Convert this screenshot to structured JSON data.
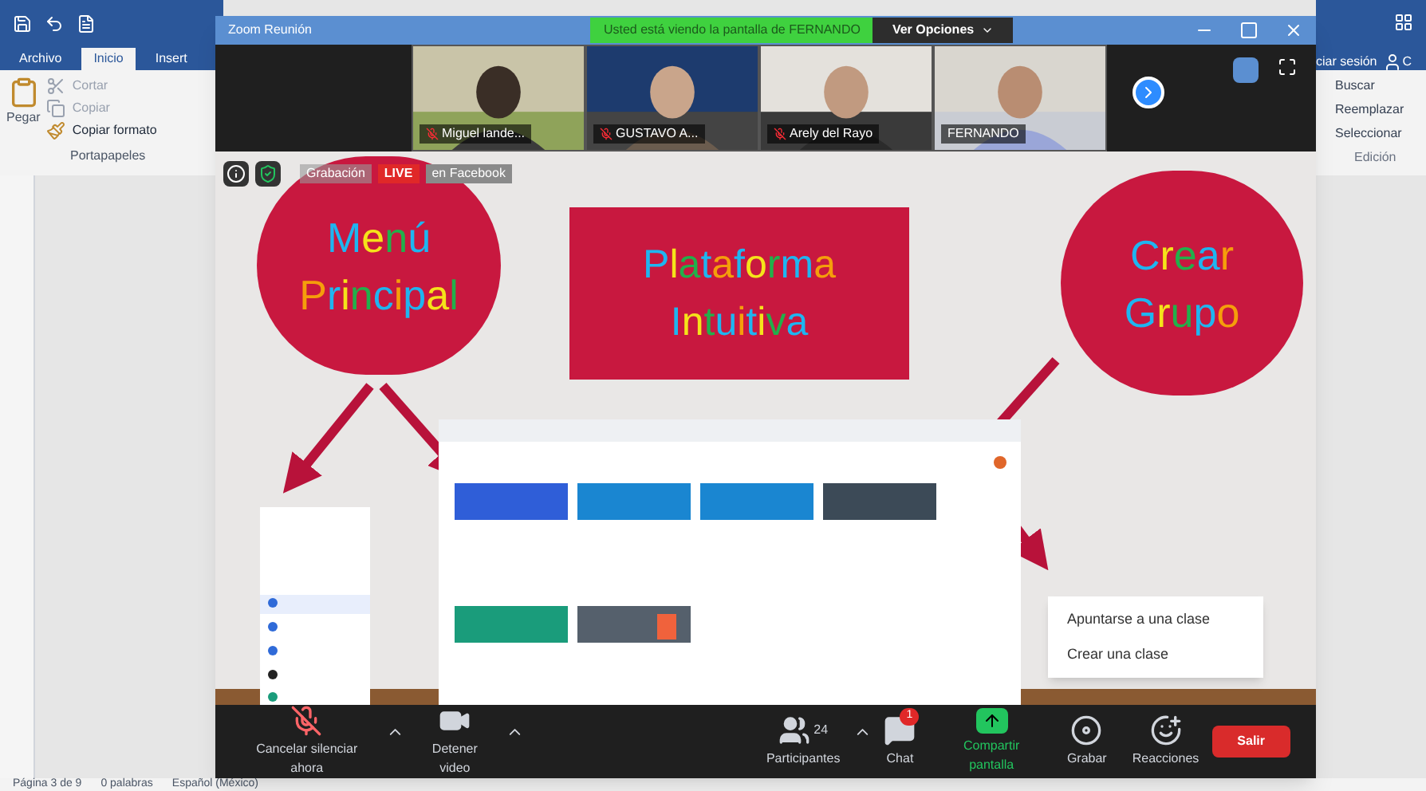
{
  "word": {
    "tabs": [
      {
        "label": "Archivo",
        "selected": false
      },
      {
        "label": "Inicio",
        "selected": true
      },
      {
        "label": "Insert",
        "selected": false
      }
    ],
    "clipboard": {
      "paste": "Pegar",
      "cut": "Cortar",
      "copy": "Copiar",
      "format_painter": "Copiar formato",
      "group": "Portapapeles"
    },
    "sign_in": "ciar sesión",
    "share": "C",
    "editing": {
      "find": "Buscar",
      "replace": "Reemplazar",
      "select": "Seleccionar",
      "group": "Edición"
    },
    "status_bar": [
      "Página 3 de 9",
      "0 palabras",
      "Español (México)"
    ]
  },
  "zoom": {
    "title": "Zoom Reunión",
    "share_banner": "Usted está viendo la pantalla de FERNANDO",
    "view_options": "Ver Opciones",
    "participants": [
      {
        "name": "Miguel lande...",
        "muted": true
      },
      {
        "name": "GUSTAVO A...",
        "muted": true
      },
      {
        "name": "Arely del Rayo",
        "muted": true
      },
      {
        "name": "FERNANDO",
        "muted": false
      }
    ],
    "recording": {
      "label": "Grabación",
      "live": "LIVE",
      "platform": "en Facebook"
    },
    "slide": {
      "bubbles": [
        {
          "kind": "circle",
          "text": "Menú Principal"
        },
        {
          "kind": "rect",
          "text": "Plataforma Intuitiva"
        },
        {
          "kind": "circle",
          "text": "Crear Grupo"
        }
      ],
      "popup": [
        "Apuntarse a una clase",
        "Crear una clase"
      ]
    },
    "toolbar": [
      {
        "kind": "mic",
        "label": "Cancelar silenciar ahora"
      },
      {
        "kind": "video",
        "label": "Detener video"
      },
      {
        "kind": "participants",
        "label": "Participantes",
        "count": "24"
      },
      {
        "kind": "chat",
        "label": "Chat",
        "badge": "1"
      },
      {
        "kind": "share",
        "label": "Compartir pantalla"
      },
      {
        "kind": "record",
        "label": "Grabar"
      },
      {
        "kind": "reactions",
        "label": "Reacciones"
      }
    ],
    "leave": "Salir"
  }
}
